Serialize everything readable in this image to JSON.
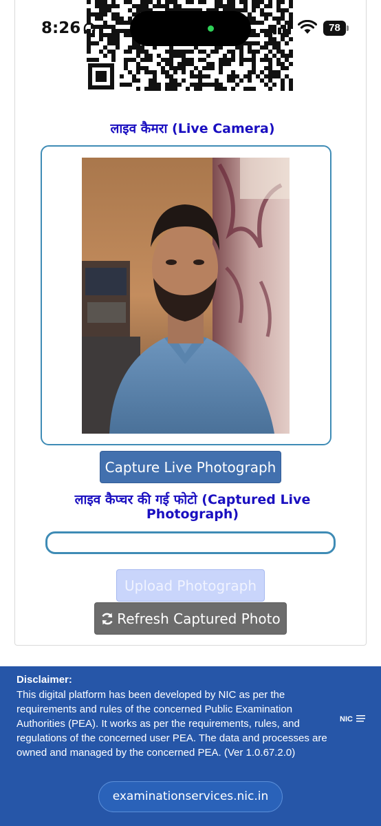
{
  "status_bar": {
    "time": "8:26",
    "battery": "78",
    "icons": [
      "headphones-icon",
      "signal-icon",
      "wifi-icon",
      "battery-icon"
    ]
  },
  "live_camera": {
    "title": "लाइव कैमरा (Live Camera)"
  },
  "buttons": {
    "capture": "Capture Live Photograph",
    "upload": "Upload Photograph",
    "refresh": "Refresh Captured Photo"
  },
  "captured": {
    "title": "लाइव कैप्चर की गई फोटो (Captured Live Photograph)"
  },
  "footer": {
    "disclaimer_title": "Disclaimer:",
    "disclaimer_text": "This digital platform has been developed by NIC as per the requirements and rules of the concerned Public Examination Authorities (PEA). It works as per the requirements, rules, and regulations of the concerned user PEA. The data and processes are owned and managed by the concerned PEA. (Ver 1.0.67.2.0)",
    "logo": "NIC",
    "site_link": "examinationservices.nic.in"
  },
  "colors": {
    "title_blue": "#1a0fc0",
    "frame_border": "#3e8bb5",
    "capture_button": "#4270ae",
    "upload_button_disabled": "#c9d5fb",
    "refresh_button": "#6c6c6c",
    "footer_bg": "#2656a8"
  }
}
